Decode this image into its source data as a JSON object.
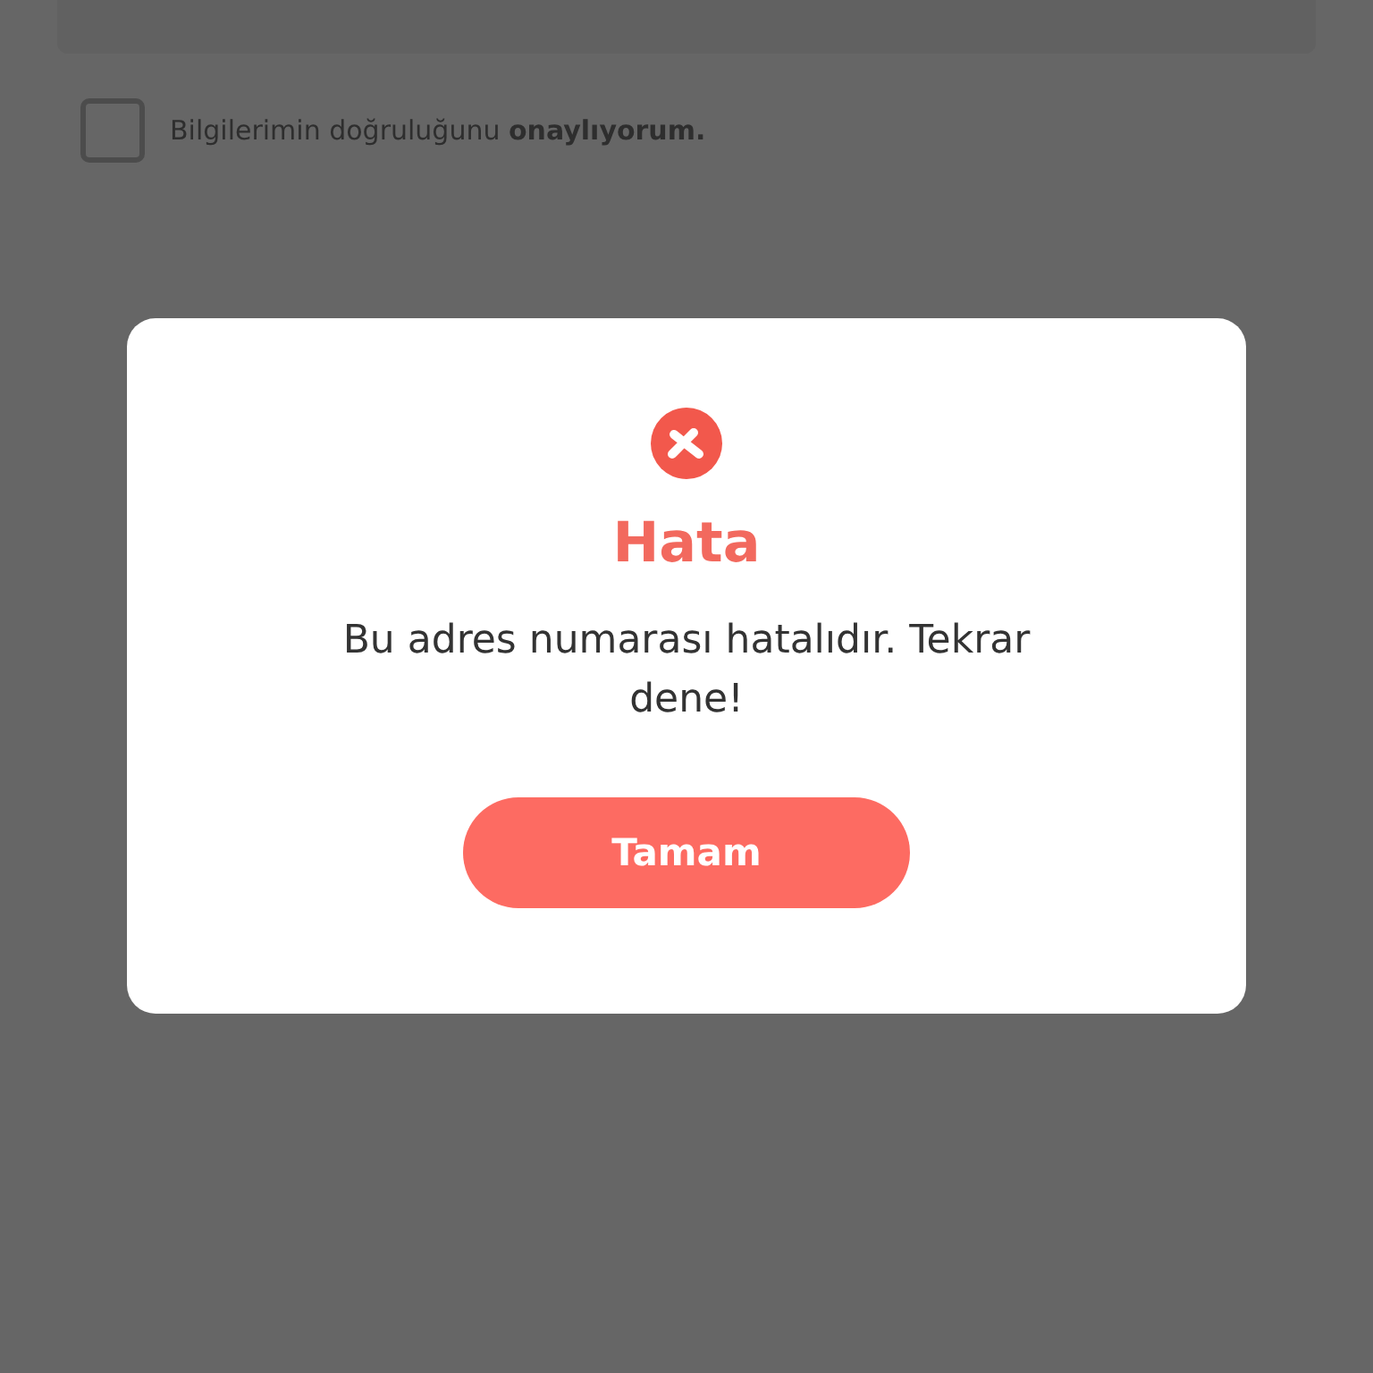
{
  "consent": {
    "label": "Bilgilerimin doğruluğunu **onaylıyorum.**",
    "checked": false
  },
  "dialog": {
    "title": "Hata",
    "message": "Bu adres numarası hatalıdır. Tekrar dene!",
    "button": "Tamam"
  }
}
